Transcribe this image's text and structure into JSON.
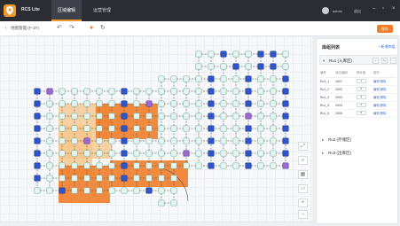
{
  "app": {
    "name": "RCS Lite"
  },
  "nav": {
    "tabs": [
      {
        "label": "区域编辑"
      },
      {
        "label": "运营管理"
      }
    ]
  },
  "user": {
    "name": "admin",
    "action": "退出"
  },
  "toolbar": {
    "breadcrumb": "地图管理 (F-1F)",
    "save_label": "保存"
  },
  "panel": {
    "title": "库组列表",
    "add_label": "+ 新增库组",
    "groups": [
      {
        "label": "Ru1 (入库区)",
        "expanded": true
      },
      {
        "label": "Ru2 (存储区)",
        "expanded": false
      },
      {
        "label": "Ru3 (出库区)",
        "expanded": false
      }
    ],
    "columns": [
      "编号",
      "库位编码",
      "排序值",
      "操作"
    ],
    "rows": [
      {
        "id": "Ru1_1",
        "code": "0001",
        "order": "1",
        "edit": "编辑",
        "del": "删除"
      },
      {
        "id": "Ru1_2",
        "code": "0002",
        "order": "2",
        "edit": "编辑",
        "del": "删除"
      },
      {
        "id": "Ru1_3",
        "code": "0003",
        "order": "3",
        "edit": "编辑",
        "del": "删除"
      },
      {
        "id": "Ru1_4",
        "code": "0004",
        "order": "4",
        "edit": "编辑",
        "del": "删除"
      },
      {
        "id": "Ru1_5",
        "code": "0005",
        "order": "5",
        "edit": "编辑",
        "del": "删除"
      }
    ]
  },
  "zoom": {
    "plus": "+",
    "minus": "−"
  },
  "colors": {
    "accent": "#ef7d2a",
    "topbar": "#2b2d33",
    "node_blue": "#2f56c8",
    "node_teal": "#7fbfb0",
    "zone_dark": "#ef7d2a",
    "zone_light": "#f7c487"
  }
}
